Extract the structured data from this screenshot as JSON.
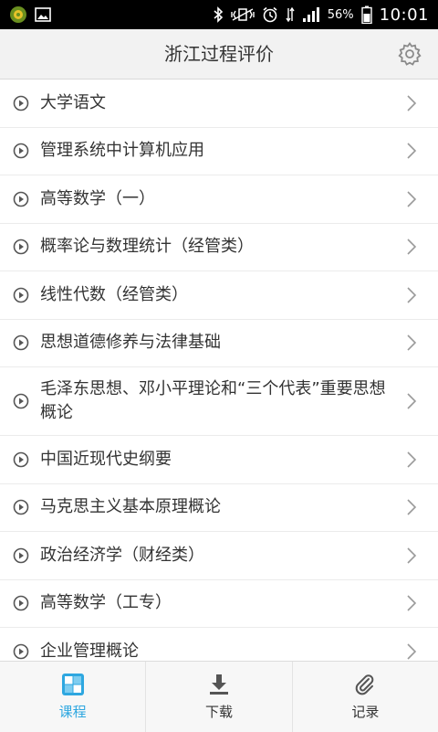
{
  "status_bar": {
    "battery_percent": "56%",
    "time": "10:01",
    "icons": [
      "app-icon",
      "image-icon",
      "bluetooth-icon",
      "vibrate-icon",
      "alarm-icon",
      "data-icon",
      "signal-icon",
      "battery-icon"
    ]
  },
  "header": {
    "title": "浙江过程评价",
    "settings_icon": "gear-icon"
  },
  "courses": [
    {
      "label": "大学语文"
    },
    {
      "label": "管理系统中计算机应用"
    },
    {
      "label": "高等数学（一）"
    },
    {
      "label": "概率论与数理统计（经管类）"
    },
    {
      "label": "线性代数（经管类）"
    },
    {
      "label": "思想道德修养与法律基础"
    },
    {
      "label": "毛泽东思想、邓小平理论和“三个代表”重要思想概论"
    },
    {
      "label": "中国近现代史纲要"
    },
    {
      "label": "马克思主义基本原理概论"
    },
    {
      "label": "政治经济学（财经类）"
    },
    {
      "label": "高等数学（工专）"
    },
    {
      "label": "企业管理概论"
    }
  ],
  "tabs": [
    {
      "label": "课程",
      "icon": "course-icon",
      "active": true
    },
    {
      "label": "下载",
      "icon": "download-icon",
      "active": false
    },
    {
      "label": "记录",
      "icon": "paperclip-icon",
      "active": false
    }
  ],
  "colors": {
    "accent": "#2ea7e0",
    "header_bg": "#f2f2f2",
    "status_bg": "#000000",
    "text": "#333333"
  }
}
